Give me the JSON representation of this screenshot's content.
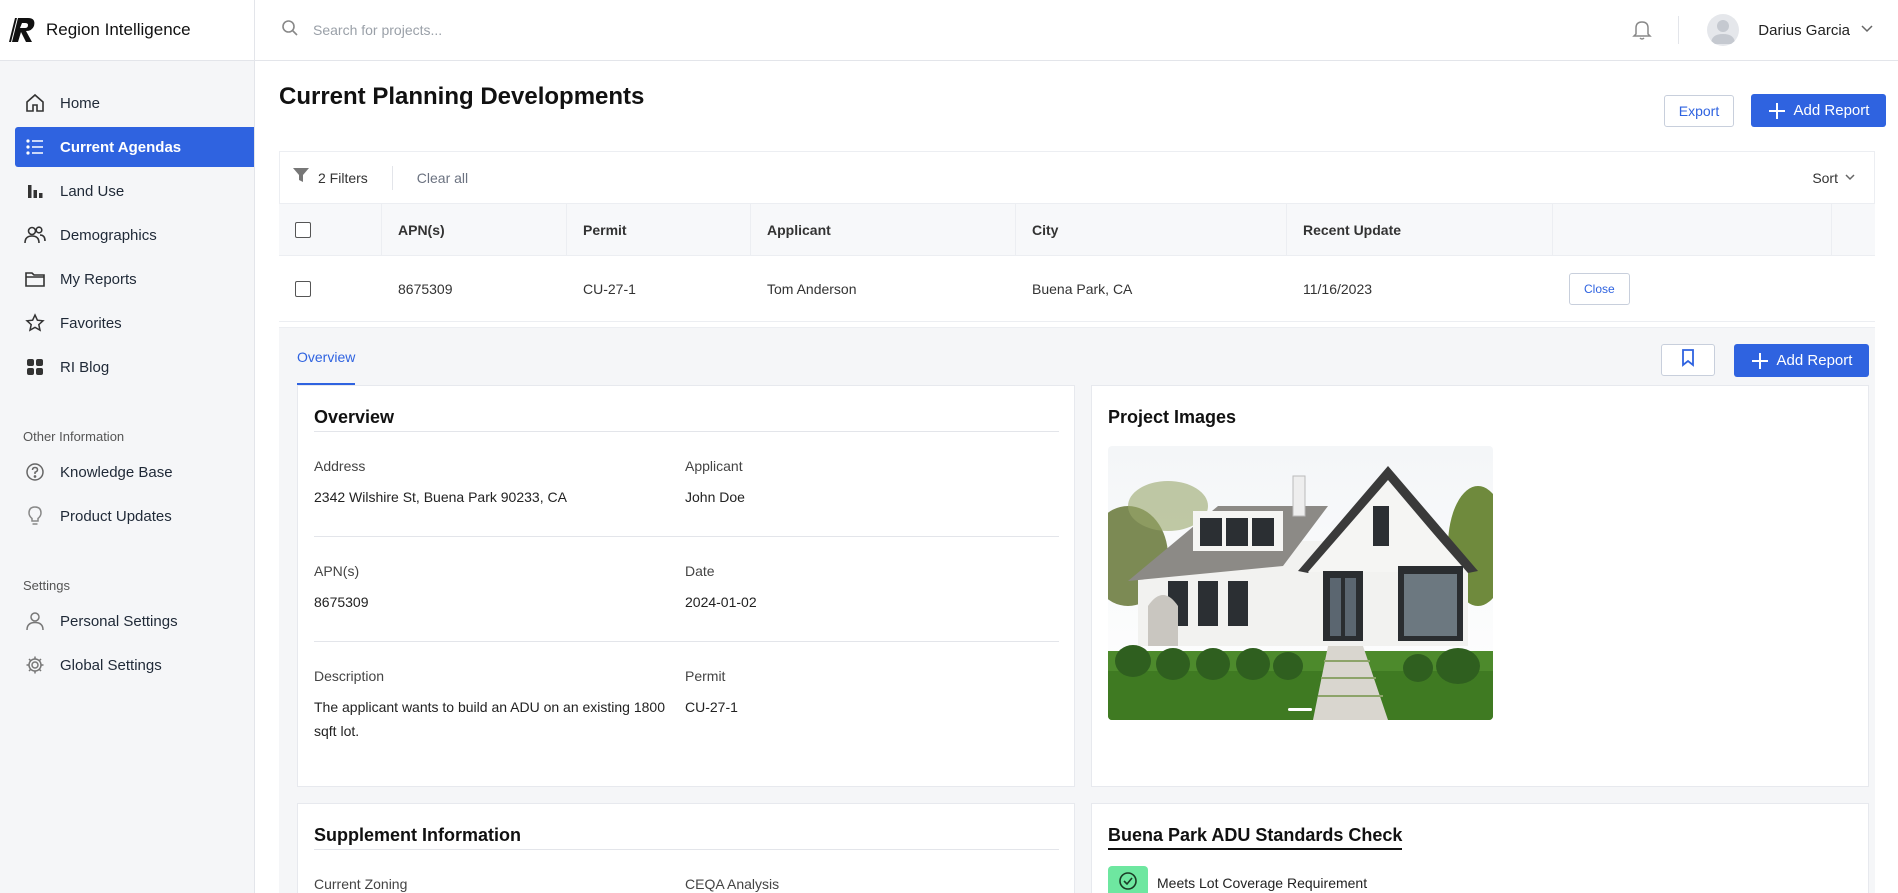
{
  "app": {
    "name": "Region Intelligence"
  },
  "sidebar": {
    "items": [
      {
        "label": "Home",
        "icon": "home-icon"
      },
      {
        "label": "Current Agendas",
        "icon": "list-icon",
        "active": true
      },
      {
        "label": "Land Use",
        "icon": "bar-chart-icon"
      },
      {
        "label": "Demographics",
        "icon": "users-icon"
      },
      {
        "label": "My Reports",
        "icon": "folder-icon"
      },
      {
        "label": "Favorites",
        "icon": "star-icon"
      },
      {
        "label": "RI Blog",
        "icon": "grid-icon"
      }
    ],
    "other_section": "Other Information",
    "other_items": [
      {
        "label": "Knowledge Base",
        "icon": "help-circle-icon"
      },
      {
        "label": "Product Updates",
        "icon": "lightbulb-icon"
      }
    ],
    "settings_section": "Settings",
    "settings_items": [
      {
        "label": "Personal Settings",
        "icon": "user-icon"
      },
      {
        "label": "Global Settings",
        "icon": "gear-icon"
      }
    ]
  },
  "topbar": {
    "search_placeholder": "Search for projects...",
    "user_name": "Darius Garcia"
  },
  "page": {
    "title": "Current Planning Developments",
    "export_label": "Export",
    "add_report_label": "Add Report"
  },
  "filters": {
    "count_label": "2 Filters",
    "clear_label": "Clear all",
    "sort_label": "Sort"
  },
  "table": {
    "headers": [
      "APN(s)",
      "Permit",
      "Applicant",
      "City",
      "Recent Update"
    ],
    "rows": [
      {
        "apn": "8675309",
        "permit": "CU-27-1",
        "applicant": "Tom Anderson",
        "city": "Buena Park, CA",
        "updated": "11/16/2023",
        "action": "Close"
      }
    ]
  },
  "detail": {
    "tab": "Overview",
    "add_report_label": "Add Report",
    "overview": {
      "title": "Overview",
      "address_label": "Address",
      "address": "2342 Wilshire St, Buena Park 90233, CA",
      "applicant_label": "Applicant",
      "applicant": "John Doe",
      "apn_label": "APN(s)",
      "apn": "8675309",
      "date_label": "Date",
      "date": "2024-01-02",
      "description_label": "Description",
      "description": "The applicant wants to build an ADU on an existing 1800 sqft lot.",
      "permit_label": "Permit",
      "permit": "CU-27-1"
    },
    "images": {
      "title": "Project Images"
    },
    "supplement": {
      "title": "Supplement Information",
      "zoning_label": "Current Zoning",
      "ceqa_label": "CEQA Analysis"
    },
    "standards": {
      "title": "Buena Park ADU Standards Check",
      "items": [
        "Meets Lot Coverage Requirement"
      ]
    }
  },
  "colors": {
    "accent": "#2f63e0",
    "success": "#6ee7a0"
  }
}
